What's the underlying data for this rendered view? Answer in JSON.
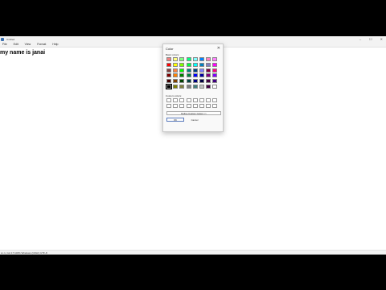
{
  "window": {
    "title": "Untitled",
    "controls": [
      "–",
      "☐",
      "✕"
    ]
  },
  "menu": {
    "items": [
      "File",
      "Edit",
      "View",
      "Format",
      "Help"
    ]
  },
  "document": {
    "text": "my name is janai"
  },
  "status": {
    "text": "Ln 1, Col 17  100%  Windows (CRLF)  UTF-8"
  },
  "dialog": {
    "title": "Color",
    "close": "✕",
    "basic_label": "Basic colors:",
    "custom_label": "Custom colors:",
    "define_label": "Define Custom Colors >>",
    "ok_label": "OK",
    "cancel_label": "Cancel",
    "basic_colors": [
      "#f08080",
      "#ffff80",
      "#80ff80",
      "#00ff80",
      "#80ffff",
      "#0080ff",
      "#ff80c0",
      "#ff80ff",
      "#ff0000",
      "#ffff00",
      "#80ff00",
      "#00ff40",
      "#00ffff",
      "#0080c0",
      "#8080c0",
      "#ff00ff",
      "#804040",
      "#ff8040",
      "#00ff00",
      "#008080",
      "#004080",
      "#8080ff",
      "#800040",
      "#ff0080",
      "#800000",
      "#ff8000",
      "#008000",
      "#008040",
      "#0000ff",
      "#0000a0",
      "#800080",
      "#8000ff",
      "#400000",
      "#804000",
      "#004000",
      "#004040",
      "#000080",
      "#000040",
      "#400040",
      "#400080",
      "#000000",
      "#808000",
      "#808040",
      "#808080",
      "#408080",
      "#c0c0c0",
      "#400040",
      "#ffffff"
    ],
    "selected_index": 40,
    "custom_colors": [
      "#ffffff",
      "#ffffff",
      "#ffffff",
      "#ffffff",
      "#ffffff",
      "#ffffff",
      "#ffffff",
      "#ffffff",
      "#ffffff",
      "#ffffff",
      "#ffffff",
      "#ffffff",
      "#ffffff",
      "#ffffff",
      "#ffffff",
      "#ffffff"
    ]
  }
}
